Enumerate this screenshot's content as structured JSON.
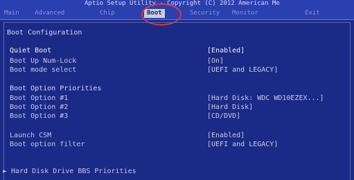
{
  "title": "Aptio Setup Utility - Copyright (C) 2012 American Me",
  "menu": {
    "items": [
      "Main",
      "Advanced",
      "Chip",
      "Boot",
      "Security",
      "Monitor",
      "Exit"
    ],
    "active": "Boot"
  },
  "section_title": "Boot Configuration",
  "settings": [
    {
      "label": "Quiet Boot",
      "value": "[Enabled]"
    },
    {
      "label": "Boot Up Num-Lock",
      "value": "[On]"
    },
    {
      "label": "Boot mode select",
      "value": "[UEFI and LEGACY]"
    }
  ],
  "priorities": {
    "title": "Boot Option Priorities",
    "options": [
      {
        "label": "Boot Option #1",
        "value": "[Hard Disk: WDC WD10EZEX...]"
      },
      {
        "label": "Boot Option #2",
        "value": "[Hard Disk]"
      },
      {
        "label": "Boot Option #3",
        "value": "[CD/DVD]"
      }
    ]
  },
  "csm": [
    {
      "label": "Launch CSM",
      "value": "[Enabled]"
    },
    {
      "label": "Boot option filter",
      "value": "[UEFI and LEGACY]"
    }
  ],
  "submenu": {
    "arrow": "►",
    "label": "Hard Disk Drive BBS Priorities"
  },
  "colors": {
    "background": "#1b2a86",
    "menu_active_bg": "#c9ced6",
    "circle": "#d93a3a"
  }
}
